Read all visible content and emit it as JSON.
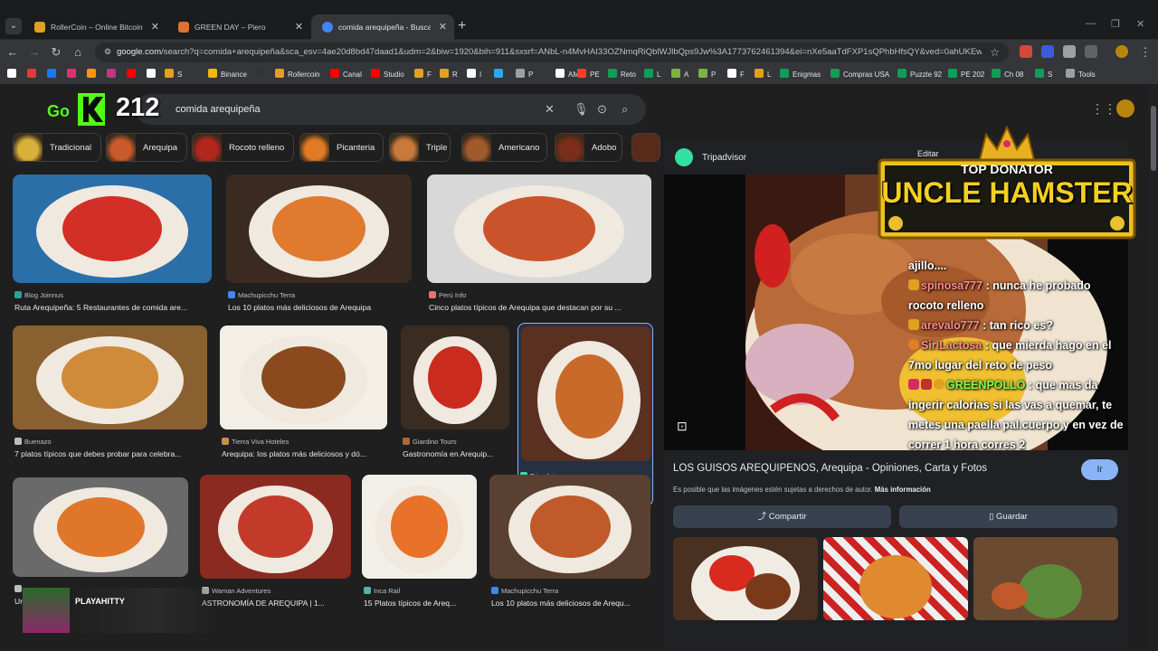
{
  "browser": {
    "tabs": [
      {
        "title": "RollerCoin – Online Bitcoin Mini",
        "favicon_color": "#e0a020"
      },
      {
        "title": "GREEN DAY – Piero",
        "favicon_color": "#e07030"
      },
      {
        "title": "comida arequipeña - Buscar con",
        "favicon_color": "#4285f4",
        "active": true
      }
    ],
    "url_prefix": "google.com",
    "url_rest": "/search?q=comida+arequipeña&sca_esv=4ae20d8bd47daad1&udm=2&biw=1920&bih=911&sxsrf=ANbL-n4MvHAI33OZNmqRiQblWJlbQps9Jw%3A1773762461394&ei=nXe5aaTdFXP1sQPhbHfsQY&ved=0ahUKEwjkn...",
    "bookmarks": [
      {
        "label": "",
        "color": "#ffffff"
      },
      {
        "label": "",
        "color": "#e53935"
      },
      {
        "label": "",
        "color": "#1877f2"
      },
      {
        "label": "",
        "color": "#e1306c"
      },
      {
        "label": "",
        "color": "#ff9800"
      },
      {
        "label": "",
        "color": "#c13584"
      },
      {
        "label": "",
        "color": "#ff0000"
      },
      {
        "label": "",
        "color": "#ffffff"
      },
      {
        "label": "S",
        "color": "#e0a020"
      },
      {
        "label": "Binance",
        "color": "#f0b90b"
      },
      {
        "label": "",
        "color": "#333333"
      },
      {
        "label": "Rollercoin",
        "color": "#e0a020"
      },
      {
        "label": "Canal",
        "color": "#ff0000"
      },
      {
        "label": "Studio",
        "color": "#ff0000"
      },
      {
        "label": "F",
        "color": "#e0a020"
      },
      {
        "label": "R",
        "color": "#e0a020"
      },
      {
        "label": "I",
        "color": "#ffffff"
      },
      {
        "label": "",
        "color": "#29a9eb"
      },
      {
        "label": "P",
        "color": "#9aa0a6"
      },
      {
        "label": "AM",
        "color": "#ffffff"
      },
      {
        "label": "PE",
        "color": "#ff3b30"
      },
      {
        "label": "Reto",
        "color": "#0f9d58"
      },
      {
        "label": "L",
        "color": "#0f9d58"
      },
      {
        "label": "A",
        "color": "#7cb342"
      },
      {
        "label": "P",
        "color": "#7cb342"
      },
      {
        "label": "F",
        "color": "#ffffff"
      },
      {
        "label": "L",
        "color": "#e0a020"
      },
      {
        "label": "Enigmas",
        "color": "#0f9d58"
      },
      {
        "label": "Compras USA",
        "color": "#0f9d58"
      },
      {
        "label": "Puzzle 92",
        "color": "#0f9d58"
      },
      {
        "label": "PE 202",
        "color": "#0f9d58"
      },
      {
        "label": "Ch 08",
        "color": "#0f9d58"
      },
      {
        "label": "S",
        "color": "#0f9d58"
      },
      {
        "label": "Tools",
        "color": "#9aa0a6"
      }
    ]
  },
  "search": {
    "query": "comida arequipeña",
    "logo_text": "212",
    "chips": [
      {
        "label": "Tradicional",
        "color": "#d9b13a"
      },
      {
        "label": "Arequipa",
        "color": "#c85a2b"
      },
      {
        "label": "Rocoto relleno",
        "color": "#b3261e"
      },
      {
        "label": "Picanteria",
        "color": "#e07b24"
      },
      {
        "label": "Triple",
        "color": "#c87a3a"
      },
      {
        "label": "Americano",
        "color": "#a05a2c"
      },
      {
        "label": "Adobo",
        "color": "#7a2e1a"
      }
    ]
  },
  "results": [
    {
      "source": "Blog Joinnus",
      "caption": "Ruta Arequipeña: 5 Restaurantes de comida are...",
      "src_color": "#26a69a",
      "bg": "#2b6fa8",
      "food": "#d22f27"
    },
    {
      "source": "Machupicchu Terra",
      "caption": "Los 10 platos más deliciosos de Arequipa",
      "src_color": "#4285f4",
      "bg": "#3a2a20",
      "food": "#e07a2e"
    },
    {
      "source": "Perú Info",
      "caption": "Cinco platos típicos de Arequipa que destacan por su ...",
      "src_color": "#e57373",
      "bg": "#d8d8d8",
      "food": "#c9542b"
    },
    {
      "source": "Buenazo",
      "caption": "7 platos típicos que debes probar para celebra...",
      "src_color": "#bdbdbd",
      "bg": "#8a6030",
      "food": "#cf8a3a"
    },
    {
      "source": "Tierra Viva Hoteles",
      "caption": "Arequipa: los platos más deliciosos y dó...",
      "src_color": "#c98e4a",
      "bg": "#f3efe6",
      "food": "#8a4a1e"
    },
    {
      "source": "Giardino Tours",
      "caption": "Gastronomía en Arequip...",
      "src_color": "#a86a3a",
      "bg": "#3a2c20",
      "food": "#c92b1e"
    },
    {
      "source": "Tripadvisor",
      "caption": "LOS GUISOS AREQUIPENOS...",
      "src_color": "#34e0a1",
      "bg": "#5a3020",
      "food": "#c86a2a",
      "selected": true
    },
    {
      "source": "",
      "caption": "Ur...",
      "src_color": "#bdbdbd",
      "bg": "#6a6a6a",
      "food": "#e0762a"
    },
    {
      "source": "Waman Adventures",
      "caption": "ASTRONOMÍA DE AREQUIPA | 1...",
      "src_color": "#bdbdbd",
      "bg": "#8a2a20",
      "food": "#c43a2a"
    },
    {
      "source": "Inca Rail",
      "caption": "15 Platos típicos de Areq...",
      "src_color": "#4db6ac",
      "bg": "#f2eee8",
      "food": "#e8722a"
    },
    {
      "source": "Machupicchu Terra",
      "caption": "Los 10 platos más deliciosos de Arequ...",
      "src_color": "#4285f4",
      "bg": "#5a4030",
      "food": "#c05a2a"
    }
  ],
  "panel": {
    "site": "Tripadvisor",
    "title": "LOS GUISOS AREQUIPENOS, Arequipa - Opiniones, Carta y Fotos",
    "note": "Es posible que las imágenes estén sujetas a derechos de autor.",
    "note_link": "Más información",
    "visit_label": "Ir",
    "share_label": "Compartir",
    "save_label": "Guardar",
    "edit_label": "Editar"
  },
  "overlay": {
    "donator_top": "TOP DONATOR",
    "donator_name": "UNCLE HAMSTER",
    "chat": [
      {
        "user": "",
        "text": "ajillo...."
      },
      {
        "user": "spinosa777",
        "text": ": nunca he probado rocoto relleno"
      },
      {
        "user": "arevalo777",
        "text": ": tan rico es?"
      },
      {
        "user": "SiriLactosa",
        "text": ": que mierda hago en el 7mo lugar del reto de peso"
      },
      {
        "user": "GREENPOLLO",
        "text": ": que mas da ingerir calorias si las vas a quemar, te metes una paella pal.cuerpo y en vez de correr 1 hora corres 2"
      }
    ],
    "playa": "PLAYAHITTY"
  }
}
